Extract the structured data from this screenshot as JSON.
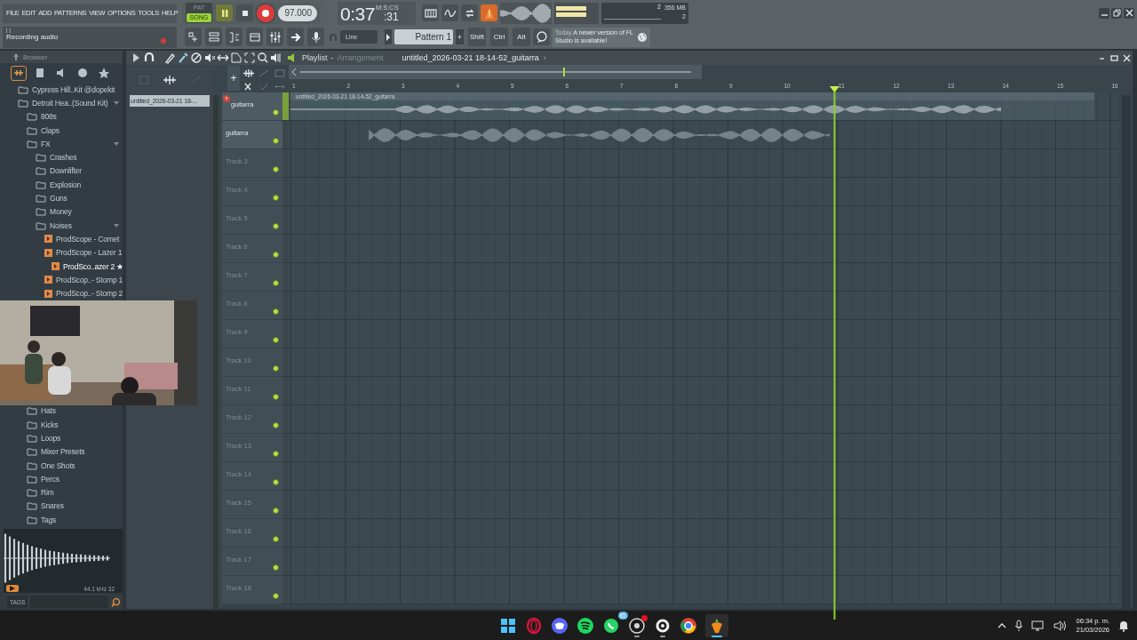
{
  "menu": [
    "FILE",
    "EDIT",
    "ADD",
    "PATTERNS",
    "VIEW",
    "OPTIONS",
    "TOOLS",
    "HELP"
  ],
  "transport": {
    "modes": [
      {
        "label": "PAT",
        "selected": false
      },
      {
        "label": "SONG",
        "selected": true
      }
    ],
    "playing": true,
    "recording": true,
    "tempo": "97.000",
    "time": "0:37",
    "time_cs": ":31",
    "time_unit": "M:S:CS"
  },
  "monitor": {
    "cpu": "2",
    "memory": "356 MB",
    "polyphony": "2"
  },
  "hint": {
    "title": "[ ]",
    "text": "Recording audio"
  },
  "snap": "Line",
  "pattern": "Pattern 1",
  "pattern_add": "+",
  "modifiers": [
    "Shift",
    "Ctrl",
    "Alt"
  ],
  "news": {
    "date": "Today",
    "text": "A newer version of FL Studio is available!"
  },
  "browser": {
    "title": "Browser",
    "tabs": [
      {
        "selected": true
      },
      {
        "selected": false
      },
      {
        "selected": false
      },
      {
        "selected": false
      },
      {
        "selected": false
      }
    ],
    "tree": [
      {
        "label": "Cypress Hill..Kit @dopekit",
        "kind": "folder",
        "expanded": false
      },
      {
        "label": "Detroit Hea..(Sound Kit)",
        "kind": "folder",
        "expanded": true,
        "children": [
          {
            "label": "808s",
            "kind": "folder",
            "expanded": false
          },
          {
            "label": "Claps",
            "kind": "folder",
            "expanded": false
          },
          {
            "label": "FX",
            "kind": "folder",
            "expanded": true,
            "children": [
              {
                "label": "Crashes",
                "kind": "folder",
                "expanded": false
              },
              {
                "label": "Downlifter",
                "kind": "folder",
                "expanded": false
              },
              {
                "label": "Explosion",
                "kind": "folder",
                "expanded": false
              },
              {
                "label": "Guns",
                "kind": "folder",
                "expanded": false
              },
              {
                "label": "Money",
                "kind": "folder",
                "expanded": false
              },
              {
                "label": "Noises",
                "kind": "folder",
                "expanded": true,
                "children": [
                  {
                    "label": "ProdScope - Comet",
                    "kind": "file",
                    "selected": false
                  },
                  {
                    "label": "ProdScope - Lazer 1",
                    "kind": "file",
                    "selected": false
                  },
                  {
                    "label": "ProdSco..azer 2 ★",
                    "kind": "file",
                    "selected": true
                  },
                  {
                    "label": "ProdScop..- Stomp 1",
                    "kind": "file",
                    "selected": false
                  },
                  {
                    "label": "ProdScop..- Stomp 2",
                    "kind": "file",
                    "selected": false
                  }
                ]
              }
            ]
          },
          {
            "label": "Hats",
            "kind": "folder",
            "expanded": false
          },
          {
            "label": "Kicks",
            "kind": "folder",
            "expanded": false
          },
          {
            "label": "Loops",
            "kind": "folder",
            "expanded": false
          },
          {
            "label": "Mixer Presets",
            "kind": "folder",
            "expanded": false
          },
          {
            "label": "One Shots",
            "kind": "folder",
            "expanded": false
          },
          {
            "label": "Percs",
            "kind": "folder",
            "expanded": false
          },
          {
            "label": "Rim",
            "kind": "folder",
            "expanded": false
          },
          {
            "label": "Snares",
            "kind": "folder",
            "expanded": false
          },
          {
            "label": "Tags",
            "kind": "folder",
            "expanded": false
          }
        ]
      }
    ],
    "preview_info": "44.1 kHz 32",
    "tags_label": "TAGS"
  },
  "webcam": {
    "kind": "picture"
  },
  "playlist": {
    "title": "Playlist",
    "separator": "-",
    "subtitle": "Arrangement",
    "pattern": "untitled_2026-03-21 18-14-52_guitarra",
    "pattern_arrow": "›",
    "picker": [
      {
        "label": "untitled_2026-03-21 18-...",
        "selected": true
      }
    ],
    "add_track": "+",
    "ruler": [
      "1",
      "2",
      "3",
      "4",
      "5",
      "6",
      "7",
      "8",
      "9",
      "10",
      "11",
      "12",
      "13",
      "14",
      "15",
      "16"
    ],
    "tracks": [
      {
        "name": "guitarra",
        "kind": "clip",
        "clip": "untitled_2026-03-21 18-14-52_guitarra",
        "armed": true
      },
      {
        "name": "guitarra",
        "kind": "recording",
        "armed": false
      },
      {
        "name": "Track 3",
        "kind": "empty",
        "armed": false
      },
      {
        "name": "Track 4",
        "kind": "empty",
        "armed": false
      },
      {
        "name": "Track 5",
        "kind": "empty",
        "armed": false
      },
      {
        "name": "Track 6",
        "kind": "empty",
        "armed": false
      },
      {
        "name": "Track 7",
        "kind": "empty",
        "armed": false
      },
      {
        "name": "Track 8",
        "kind": "empty",
        "armed": false
      },
      {
        "name": "Track 9",
        "kind": "empty",
        "armed": false
      },
      {
        "name": "Track 10",
        "kind": "empty",
        "armed": false
      },
      {
        "name": "Track 11",
        "kind": "empty",
        "armed": false
      },
      {
        "name": "Track 12",
        "kind": "empty",
        "armed": false
      },
      {
        "name": "Track 13",
        "kind": "empty",
        "armed": false
      },
      {
        "name": "Track 14",
        "kind": "empty",
        "armed": false
      },
      {
        "name": "Track 15",
        "kind": "empty",
        "armed": false
      },
      {
        "name": "Track 16",
        "kind": "empty",
        "armed": false
      },
      {
        "name": "Track 17",
        "kind": "empty",
        "armed": false
      },
      {
        "name": "Track 18",
        "kind": "empty",
        "armed": false
      }
    ]
  },
  "taskbar": {
    "apps": [
      {
        "kind": "start",
        "running": false,
        "active": false
      },
      {
        "kind": "ring",
        "running": false,
        "active": false
      },
      {
        "kind": "chat",
        "running": false,
        "active": false
      },
      {
        "kind": "music",
        "running": false,
        "active": false
      },
      {
        "kind": "phone",
        "running": false,
        "active": false,
        "badge": "85"
      },
      {
        "kind": "record",
        "running": true,
        "active": false,
        "alert": true
      },
      {
        "kind": "gear",
        "running": true,
        "active": false
      },
      {
        "kind": "browser",
        "running": false,
        "active": false
      },
      {
        "kind": "fruit",
        "running": true,
        "active": true
      }
    ],
    "tray_time": "06:34 p. m.",
    "tray_date": "21/03/2026"
  }
}
